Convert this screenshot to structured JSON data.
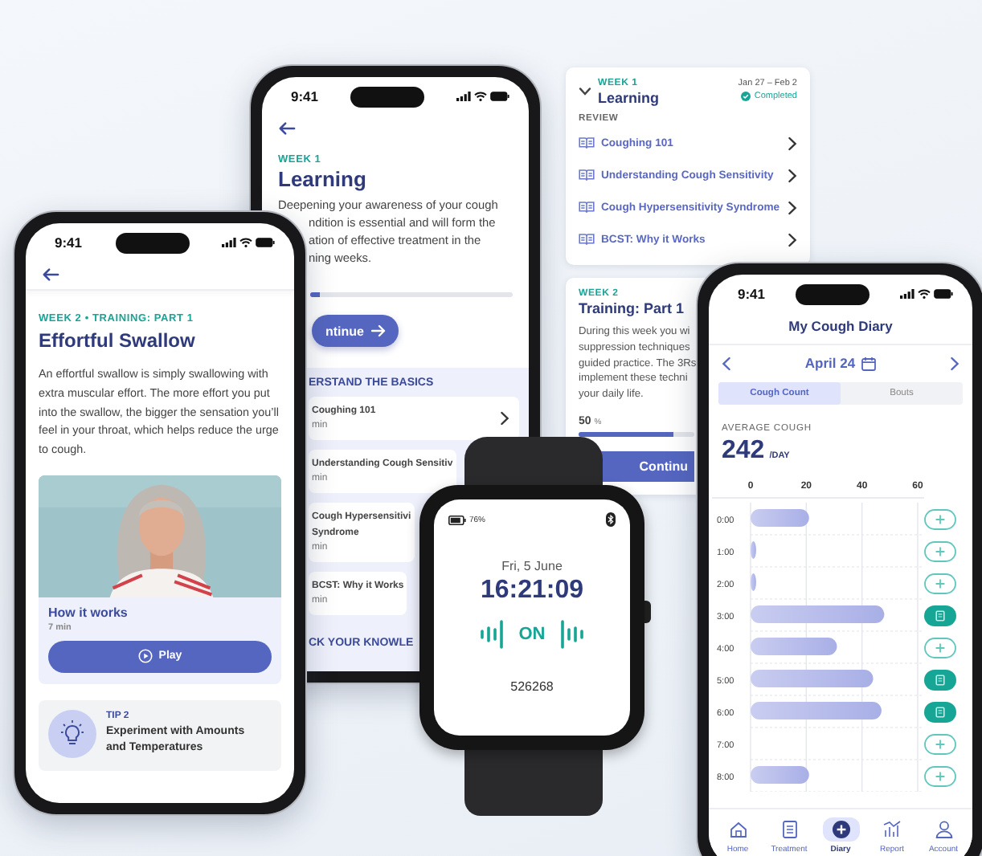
{
  "learning_phone": {
    "status_time": "9:41",
    "eyebrow": "WEEK 1",
    "title": "Learning",
    "description_lines": [
      "Deepening your awareness of your cough",
      "ndition is essential and will form the",
      "ation of effective treatment in the",
      "ning weeks."
    ],
    "progress": {
      "level": 0.05
    },
    "continue_button": "ntinue",
    "section_title": "ERSTAND THE BASICS",
    "lessons": [
      {
        "title_lines": [
          "Coughing 101"
        ],
        "duration": "min",
        "has_chevron": true
      },
      {
        "title_lines": [
          "Understanding Cough Sensitiv"
        ],
        "duration": "min",
        "has_chevron": false
      },
      {
        "title_lines": [
          "Cough Hypersensitivi",
          "Syndrome"
        ],
        "duration": "min",
        "has_chevron": false
      },
      {
        "title_lines": [
          "BCST: Why it Works"
        ],
        "duration": "min",
        "has_chevron": false
      }
    ],
    "next_section_title": "CK YOUR KNOWLE"
  },
  "week1_card": {
    "eyebrow": "WEEK 1",
    "title": "Learning",
    "expanded": true,
    "dates": "Jan 27 – Feb 2",
    "status": "Completed",
    "review_label": "REVIEW",
    "review_items": [
      "Coughing 101",
      "Understanding Cough Sensitivity",
      "Cough Hypersensitivity Syndrome",
      "BCST: Why it Works"
    ]
  },
  "week2_card": {
    "eyebrow": "WEEK 2",
    "title": "Training: Part 1",
    "description_lines": [
      "During this week you wi",
      "suppression techniques",
      "guided practice. The 3Rs",
      "implement these techni",
      "your daily life."
    ],
    "percent": "50",
    "percent_unit": "%",
    "progress": {
      "level": 0.82
    },
    "continue_button": "Continu"
  },
  "exercise_phone": {
    "status_time": "9:41",
    "eyebrow": "WEEK 2 • TRAINING: PART 1",
    "title": "Effortful Swallow",
    "description": "An effortful swallow is simply swallowing with extra muscular effort. The more effort you put into the swallow, the bigger the sensation you’ll feel in your throat, which helps reduce the urge to cough.",
    "video": {
      "kind": "picture",
      "title": "How it works",
      "duration": "7 min",
      "play_button": "Play"
    },
    "tip": {
      "label": "TIP 2",
      "text": "Experiment with Amounts and Temperatures"
    }
  },
  "watch": {
    "battery": "76%",
    "date": "Fri, 5 June",
    "time": "16:21:09",
    "status": "ON",
    "code": "526268"
  },
  "diary_phone": {
    "status_time": "9:41",
    "title": "My Cough Diary",
    "date": "April 24",
    "segments": [
      {
        "label": "Cough Count",
        "selected": true
      },
      {
        "label": "Bouts",
        "selected": false
      }
    ],
    "stat_label": "AVERAGE COUGH",
    "stat_value": "242",
    "stat_unit": "/DAY",
    "chart_data": {
      "type": "bar",
      "orientation": "horizontal",
      "categories": [
        "0:00",
        "1:00",
        "2:00",
        "3:00",
        "4:00",
        "5:00",
        "6:00",
        "7:00",
        "8:00"
      ],
      "values": [
        21,
        2,
        2,
        48,
        31,
        44,
        47,
        0,
        21
      ],
      "xticks": [
        0,
        20,
        40,
        60
      ],
      "xlim": [
        0,
        60
      ]
    },
    "row_actions": [
      {
        "kind": "add"
      },
      {
        "kind": "add"
      },
      {
        "kind": "add"
      },
      {
        "kind": "note"
      },
      {
        "kind": "add"
      },
      {
        "kind": "note"
      },
      {
        "kind": "note"
      },
      {
        "kind": "add"
      },
      {
        "kind": "add"
      }
    ],
    "nav": [
      {
        "label": "Home",
        "selected": false
      },
      {
        "label": "Treatment",
        "selected": false
      },
      {
        "label": "Diary",
        "selected": true
      },
      {
        "label": "Report",
        "selected": false
      },
      {
        "label": "Account",
        "selected": false
      }
    ]
  }
}
